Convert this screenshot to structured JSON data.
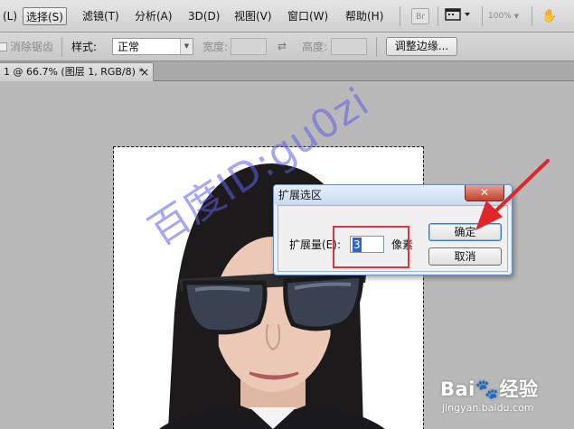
{
  "menubar": {
    "items": [
      {
        "label": "(L)"
      },
      {
        "label": "选择(S)",
        "active": true
      },
      {
        "label": "滤镜(T)"
      },
      {
        "label": "分析(A)"
      },
      {
        "label": "3D(D)"
      },
      {
        "label": "视图(V)"
      },
      {
        "label": "窗口(W)"
      },
      {
        "label": "帮助(H)"
      }
    ],
    "bridge_label": "Br",
    "zoom": "100%",
    "icons": [
      "screen-mode-icon",
      "hand-tool-icon"
    ]
  },
  "options": {
    "antialias_label": "消除锯齿",
    "style_label": "样式:",
    "style_value": "正常",
    "width_label": "宽度:",
    "height_label": "高度:",
    "refine_edge_label": "调整边缘..."
  },
  "document": {
    "tab_title": "1 @ 66.7% (图层 1, RGB/8) *",
    "close_glyph": "×"
  },
  "dialog": {
    "title": "扩展选区",
    "close_glyph": "✕",
    "amount_label": "扩展量(E):",
    "amount_value": "3",
    "unit_label": "像素",
    "ok_label": "确定",
    "cancel_label": "取消"
  },
  "watermark": {
    "text": "百度ID:gu0zi"
  },
  "branding": {
    "logo_text": "Bai",
    "logo_suffix": "经验",
    "url": "jingyan.baidu.com"
  },
  "colors": {
    "annotation_red": "#e0262b",
    "dialog_border": "#6e8fb6",
    "watermark": "#5f5fe6"
  }
}
